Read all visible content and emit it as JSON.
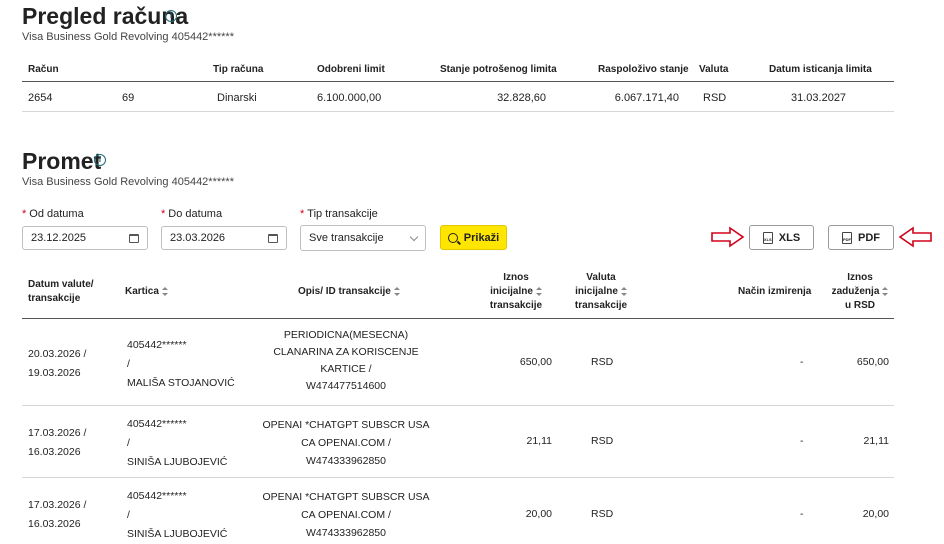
{
  "overview": {
    "title": "Pregled računa",
    "subtitle": "Visa Business Gold Revolving 405442******",
    "headers": [
      "Račun",
      "Tip računa",
      "Odobreni limit",
      "Stanje potrošenog limita",
      "Raspoloživo stanje",
      "Valuta",
      "Datum isticanja limita"
    ],
    "row": {
      "account_part1": "2654",
      "account_part2": "69",
      "type": "Dinarski",
      "limit": "6.100.000,00",
      "spent": "32.828,60",
      "available": "6.067.171,40",
      "currency": "RSD",
      "expiry": "31.03.2027"
    }
  },
  "turnover": {
    "title": "Promet",
    "subtitle": "Visa Business Gold Revolving 405442******"
  },
  "filters": {
    "from_label": "Od datuma",
    "from_value": "23.12.2025",
    "to_label": "Do datuma",
    "to_value": "23.03.2026",
    "type_label": "Tip transakcije",
    "type_value": "Sve transakcije",
    "show_label": "Prikaži",
    "xls_label": "XLS",
    "pdf_label": "PDF",
    "xls_icon_text": "XLS",
    "pdf_icon_text": "PDF"
  },
  "table": {
    "headers": {
      "date": [
        "Datum valute/",
        "transakcije"
      ],
      "card": "Kartica",
      "desc": "Opis/ ID transakcije",
      "amount": [
        "Iznos",
        "inicijalne",
        "transakcije"
      ],
      "currency": [
        "Valuta",
        "inicijalne",
        "transakcije"
      ],
      "method": "Način izmirenja",
      "charge": [
        "Iznos",
        "zaduženja",
        "u RSD"
      ]
    },
    "rows": [
      {
        "date": [
          "20.03.2026 /",
          "19.03.2026"
        ],
        "card": [
          "405442******",
          "/",
          "MALIŠA STOJANOVIĆ"
        ],
        "desc": [
          "PERIODICNA(MESECNA)",
          "CLANARINA ZA KORISCENJE",
          "KARTICE /",
          "W474477514600"
        ],
        "amount": "650,00",
        "currency": "RSD",
        "method": "-",
        "charge": "650,00"
      },
      {
        "date": [
          "17.03.2026 /",
          "16.03.2026"
        ],
        "card": [
          "405442******",
          "/",
          "SINIŠA LJUBOJEVIĆ"
        ],
        "desc": [
          "OPENAI *CHATGPT SUBSCR USA",
          "CA OPENAI.COM /",
          "W474333962850"
        ],
        "amount": "21,11",
        "currency": "RSD",
        "method": "-",
        "charge": "21,11"
      },
      {
        "date": [
          "17.03.2026 /",
          "16.03.2026"
        ],
        "card": [
          "405442******",
          "/",
          "SINIŠA LJUBOJEVIĆ"
        ],
        "desc": [
          "OPENAI *CHATGPT SUBSCR USA",
          "CA OPENAI.COM /",
          "W474333962850"
        ],
        "amount": "20,00",
        "currency": "RSD",
        "method": "-",
        "charge": "20,00"
      }
    ]
  },
  "colors": {
    "accent_yellow": "#ffe600",
    "arrow_red": "#d0021b",
    "info_teal": "#1f6b74"
  }
}
